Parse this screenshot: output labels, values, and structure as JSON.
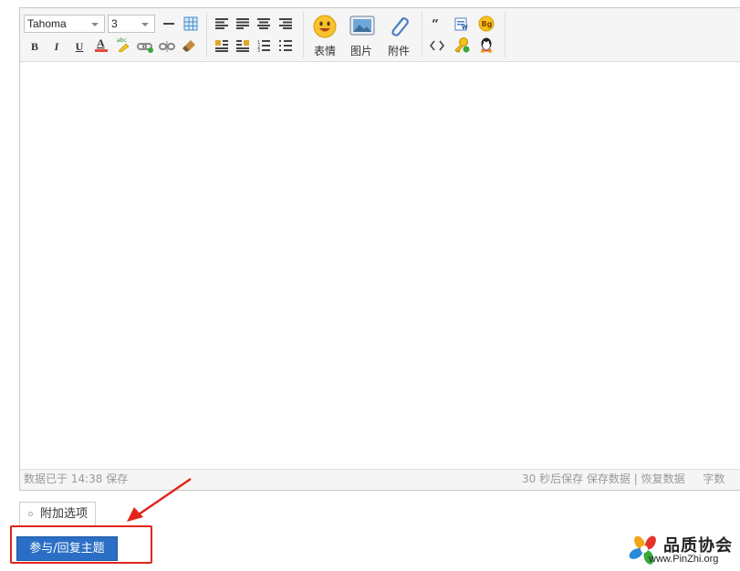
{
  "toolbar": {
    "font_family": "Tahoma",
    "font_size": "3",
    "buttons": {
      "bold": "B",
      "italic": "I",
      "underline": "U",
      "font_color": "A"
    },
    "big_buttons": {
      "emoji": "表情",
      "image": "图片",
      "attachment": "附件"
    },
    "icons": [
      "hr-icon",
      "table-icon",
      "align-left-icon",
      "align-justify-icon",
      "align-center-icon",
      "align-right-icon",
      "float-left-icon",
      "float-right-icon",
      "ordered-list-icon",
      "unordered-list-icon",
      "bold-icon",
      "italic-icon",
      "underline-icon",
      "font-color-icon",
      "highlight-icon",
      "link-icon",
      "unlink-icon",
      "clear-format-icon",
      "quote-icon",
      "word-paste-icon",
      "bg-icon",
      "code-icon",
      "hide-content-icon",
      "qq-icon"
    ]
  },
  "statusbar": {
    "left_text": "数据已于 14:38 保存",
    "autosave_text": "30 秒后保存",
    "save_link": "保存数据",
    "divider": "|",
    "restore_link": "恢复数据",
    "word_count": "字数"
  },
  "extra_options_tab": "附加选项",
  "submit_button": "参与/回复主题",
  "logo": {
    "name": "品质协会",
    "url": "www.PinZhi.org"
  },
  "colors": {
    "accent": "#2b6ec5",
    "annotation": "#e1251b"
  }
}
